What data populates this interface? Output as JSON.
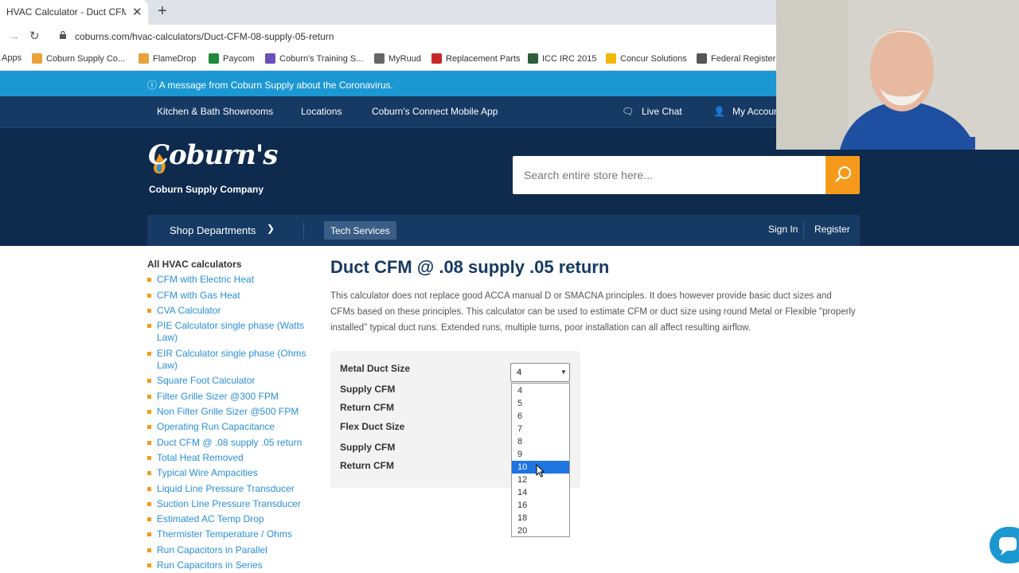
{
  "browser": {
    "tab_title": "HVAC Calculator - Duct CFM @ .",
    "tab_close": "✕",
    "new_tab": "+",
    "url": "coburns.com/hvac-calculators/Duct-CFM-08-supply-05-return",
    "bookmarks": [
      {
        "label": "Apps",
        "color": "#4a8af4"
      },
      {
        "label": "Coburn Supply Co...",
        "color": "#e9a23b"
      },
      {
        "label": "FlameDrop",
        "color": "#e9a23b"
      },
      {
        "label": "Paycom",
        "color": "#1d8b3a"
      },
      {
        "label": "Coburn's Training S...",
        "color": "#6b4fb8"
      },
      {
        "label": "MyRuud",
        "color": "#666666"
      },
      {
        "label": "Replacement Parts",
        "color": "#c62828"
      },
      {
        "label": "ICC IRC 2015",
        "color": "#2e5d3a"
      },
      {
        "label": "Concur Solutions",
        "color": "#f2b705"
      },
      {
        "label": "Federal Register",
        "color": "#555555"
      }
    ]
  },
  "alert": {
    "text": "A message from Coburn Supply about the Coronavirus."
  },
  "topnav": {
    "links": [
      "Kitchen & Bath Showrooms",
      "Locations",
      "Coburn's Connect Mobile App"
    ],
    "live_chat": "Live Chat",
    "my_account": "My Accoun"
  },
  "header": {
    "logo_script": "Coburn's",
    "logo_sub": "Coburn Supply Company",
    "search_placeholder": "Search entire store here..."
  },
  "mainnav": {
    "shop_departments": "Shop Departments",
    "tech_services": "Tech Services",
    "sign_in": "Sign In",
    "register": "Register"
  },
  "sidebar": {
    "title": "All HVAC calculators",
    "items": [
      "CFM with Electric Heat",
      "CFM with Gas Heat",
      "CVA Calculator",
      "PIE Calculator single phase (Watts Law)",
      "EIR Calculator single phase (Ohms Law)",
      "Square Foot Calculator",
      "Filter Grille Sizer @300 FPM",
      "Non Filter Grille Sizer @500 FPM",
      "Operating Run Capacitance",
      "Duct CFM @ .08 supply .05 return",
      "Total Heat Removed",
      "Typical Wire Ampacities",
      "Liquid Line Pressure Transducer",
      "Suction Line Pressure Transducer",
      "Estimated AC Temp Drop",
      "Thermister Temperature / Ohms",
      "Run Capacitors in Parallel",
      "Run Capacitors in Series"
    ]
  },
  "main": {
    "title": "Duct CFM @ .08 supply .05 return",
    "intro": "This calculator does not replace good ACCA manual D or SMACNA principles. It does however provide basic duct sizes and CFMs based on these principles. This calculator can be used to estimate CFM or duct size using round Metal or Flexible \"properly installed\" typical duct runs. Extended runs, multiple turns, poor installation can all affect resulting airflow.",
    "calc": {
      "metal_duct_size": "Metal Duct Size",
      "supply_cfm_1": "Supply CFM",
      "return_cfm_1": "Return CFM",
      "flex_duct_size": "Flex Duct Size",
      "supply_cfm_2": "Supply CFM",
      "return_cfm_2": "Return CFM",
      "selected_value": "4",
      "options": [
        "4",
        "5",
        "6",
        "7",
        "8",
        "9",
        "10",
        "12",
        "14",
        "16",
        "18",
        "20"
      ],
      "highlighted_option": "10"
    }
  },
  "colors": {
    "alert_blue": "#1b97d2",
    "navy": "#0e2a4d",
    "accent_orange": "#f59a1a",
    "link_blue": "#2a8fd6"
  }
}
